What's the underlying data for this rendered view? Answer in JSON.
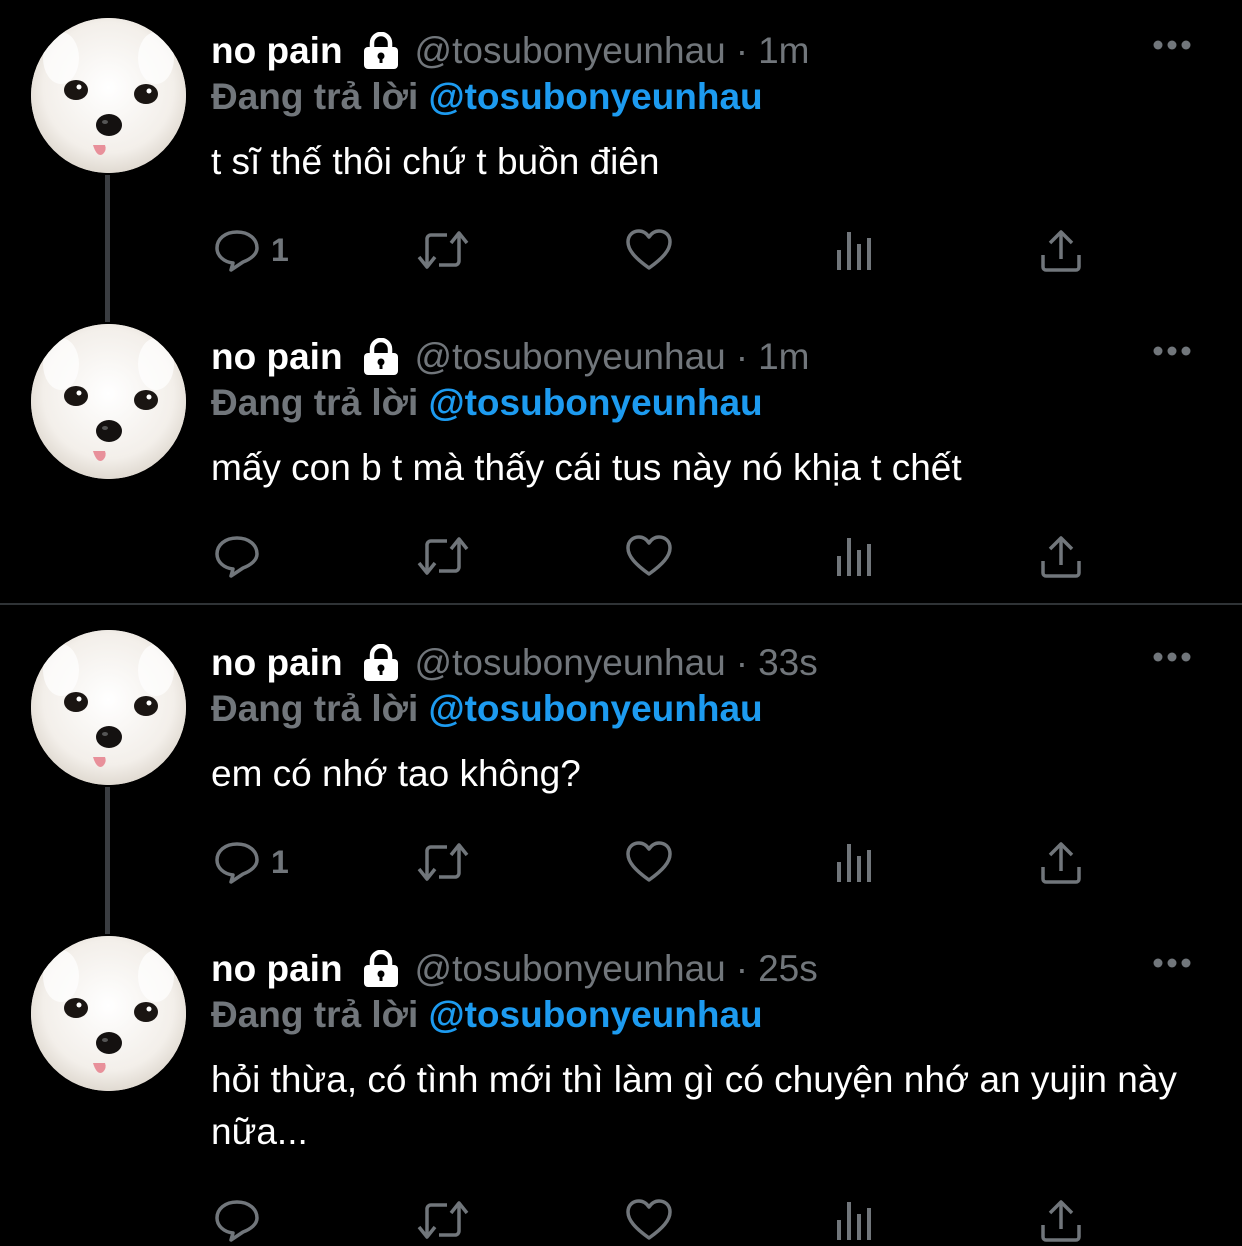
{
  "tweets": [
    {
      "name": "no pain",
      "handle": "@tosubonyeunhau",
      "time": "1m",
      "reply_label": "Đang trả lời",
      "reply_mention": "@tosubonyeunhau",
      "text": "t sĩ thế thôi chứ t buồn điên",
      "reply_count": "1"
    },
    {
      "name": "no pain",
      "handle": "@tosubonyeunhau",
      "time": "1m",
      "reply_label": "Đang trả lời",
      "reply_mention": "@tosubonyeunhau",
      "text": "mấy con b t mà thấy cái tus này nó khịa t chết",
      "reply_count": ""
    },
    {
      "name": "no pain",
      "handle": "@tosubonyeunhau",
      "time": "33s",
      "reply_label": "Đang trả lời",
      "reply_mention": "@tosubonyeunhau",
      "text": "em có nhớ tao không?",
      "reply_count": "1"
    },
    {
      "name": "no pain",
      "handle": "@tosubonyeunhau",
      "time": "25s",
      "reply_label": "Đang trả lời",
      "reply_mention": "@tosubonyeunhau",
      "text": "hỏi thừa, có tình mới thì làm gì có chuyện nhớ an yujin này nữa...",
      "reply_count": ""
    }
  ],
  "separator": "·",
  "icons": {
    "verified": "lock-icon",
    "more": "more-options-icon",
    "reply": "reply-icon",
    "retweet": "retweet-icon",
    "like": "like-icon",
    "views": "views-icon",
    "share": "share-icon"
  },
  "colors": {
    "background": "#000000",
    "name": "#ffffff",
    "muted": "#71767b",
    "mention": "#1d9bf0",
    "thread_line": "#3a3d41"
  }
}
